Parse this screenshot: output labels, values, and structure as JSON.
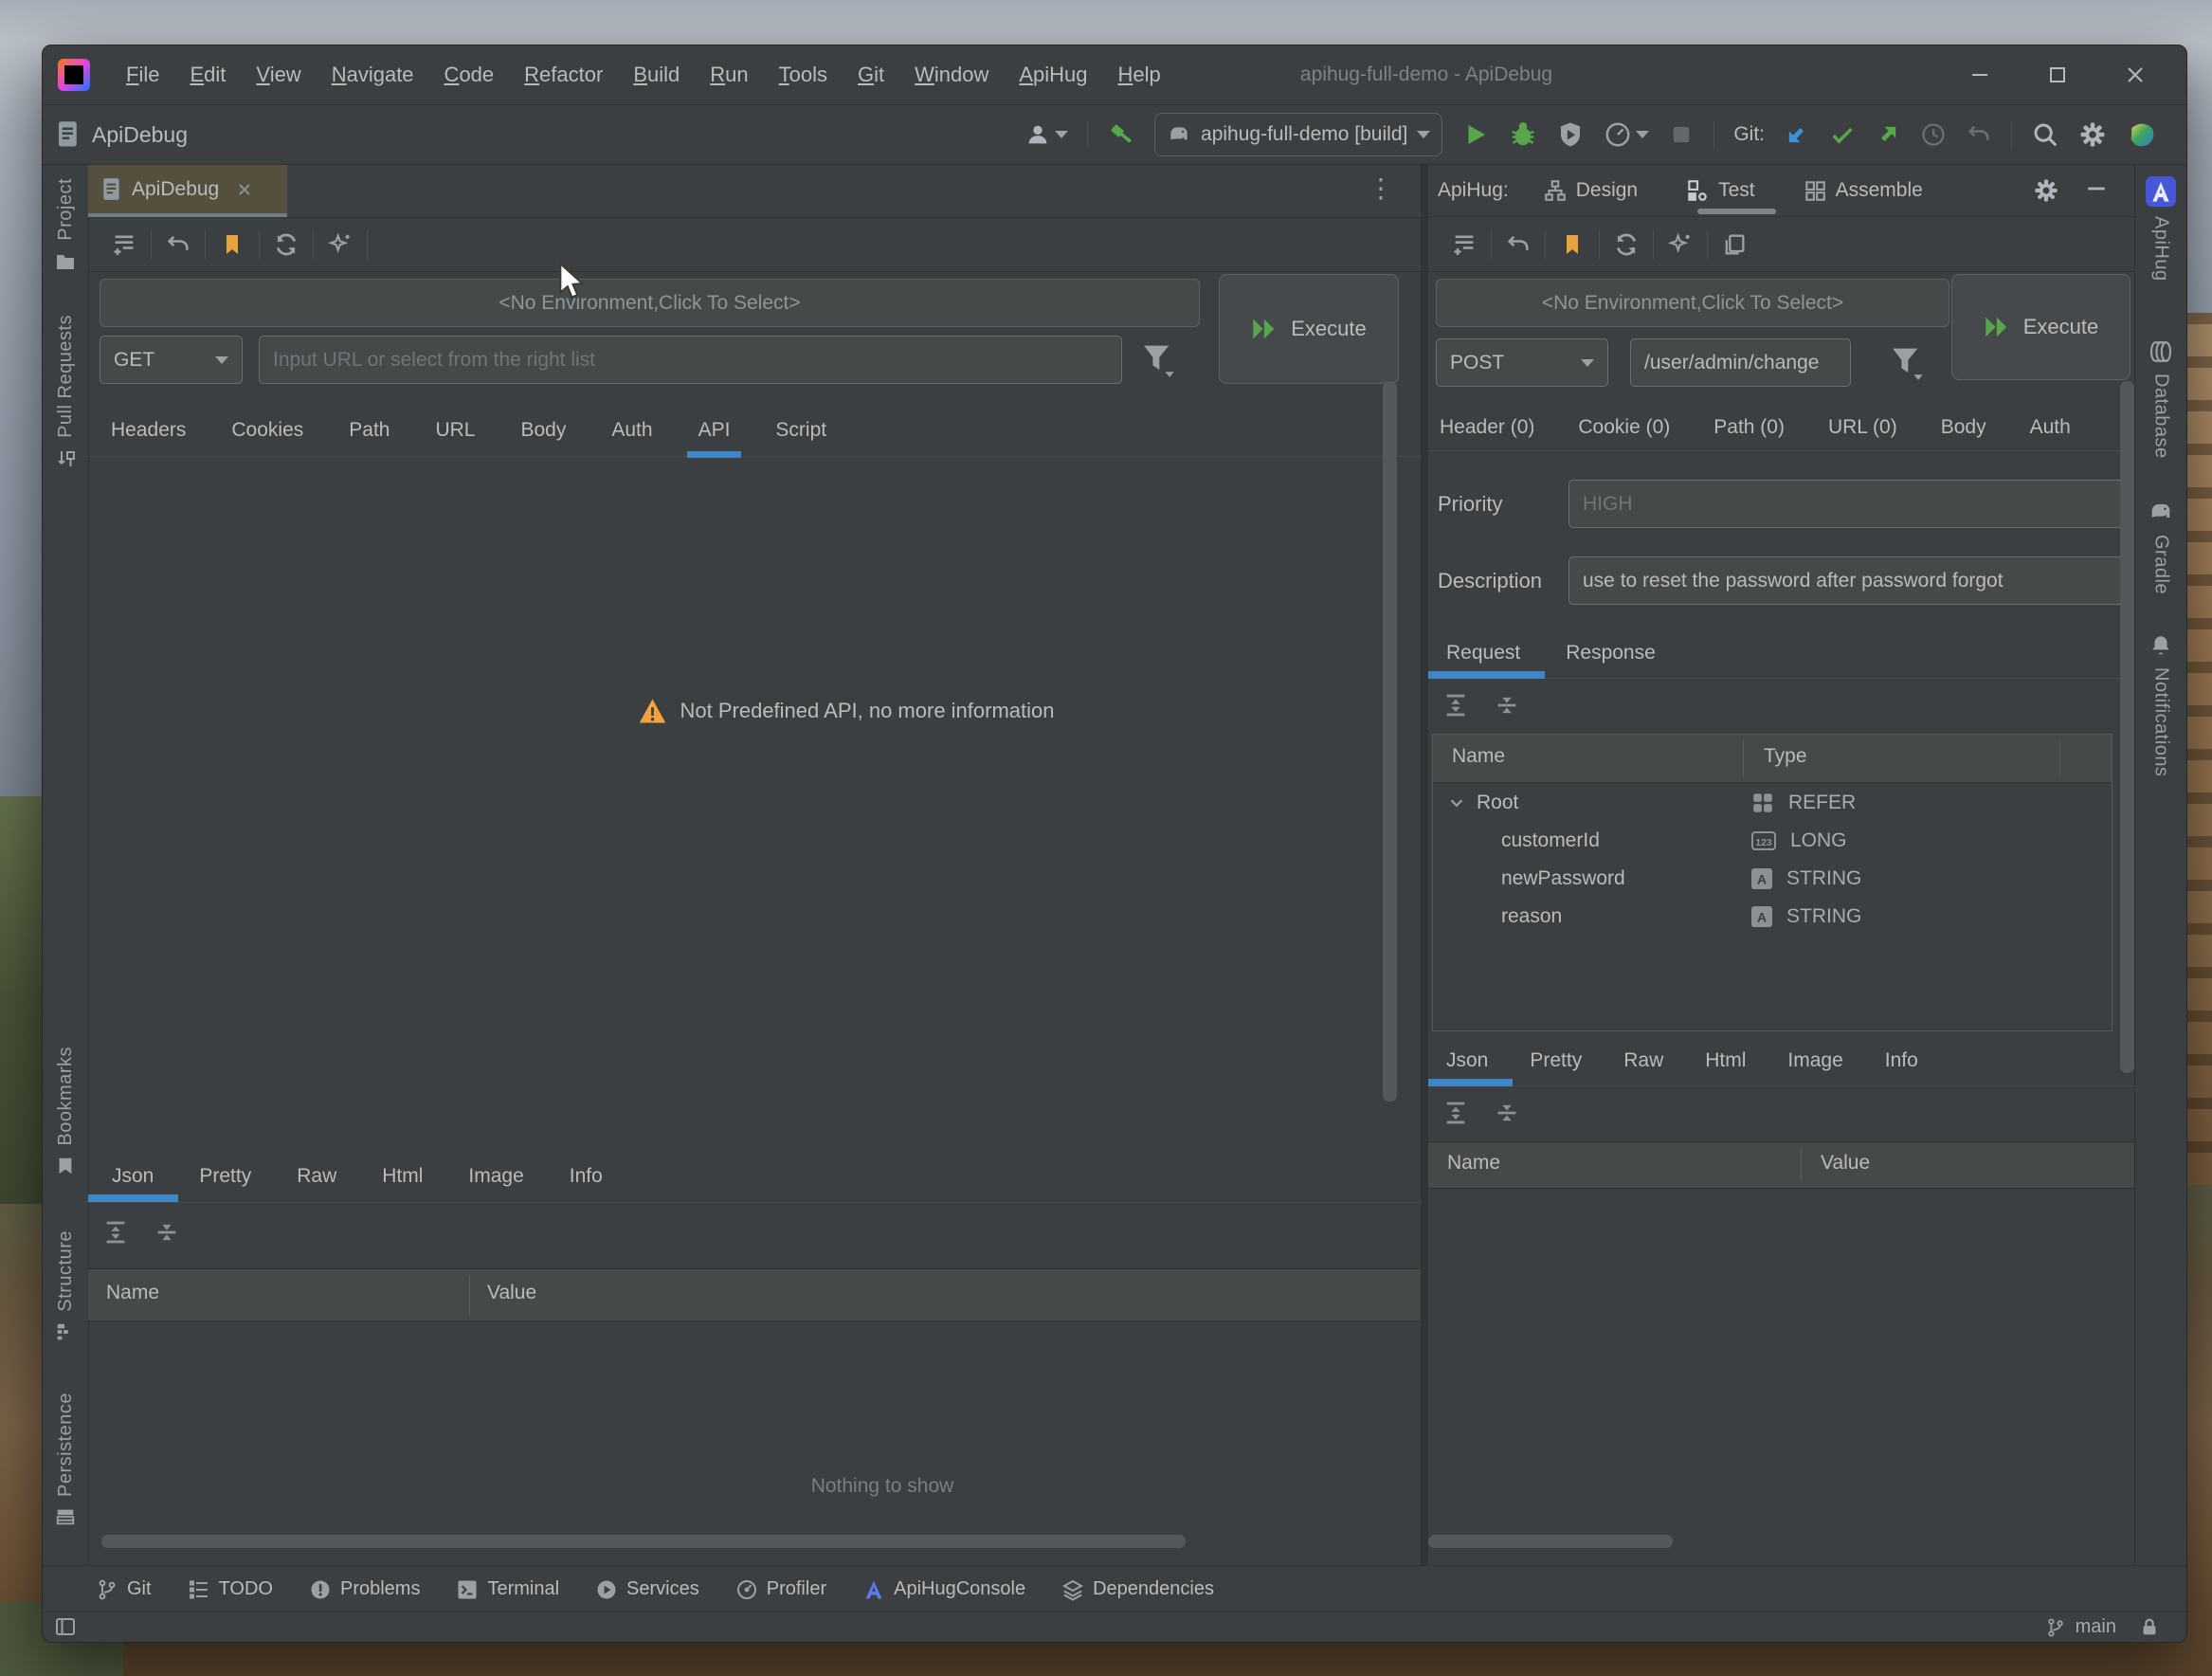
{
  "titlebar": {
    "menus": [
      "File",
      "Edit",
      "View",
      "Navigate",
      "Code",
      "Refactor",
      "Build",
      "Run",
      "Tools",
      "Git",
      "Window",
      "ApiHug",
      "Help"
    ],
    "title": "apihug-full-demo - ApiDebug"
  },
  "toolbar": {
    "app_label": "ApiDebug",
    "run_config": "apihug-full-demo [build]",
    "git_label": "Git:"
  },
  "left_stripe": {
    "project": "Project",
    "pull_requests": "Pull Requests",
    "bookmarks": "Bookmarks",
    "structure": "Structure",
    "persistence": "Persistence"
  },
  "left": {
    "tab": "ApiDebug",
    "env": "<No Environment,Click To Select>",
    "method": "GET",
    "url_placeholder": "Input URL or select from the right list",
    "execute": "Execute",
    "req_tabs": [
      "Headers",
      "Cookies",
      "Path",
      "URL",
      "Body",
      "Auth",
      "API",
      "Script"
    ],
    "active_req_tab": "API",
    "warning": "Not Predefined API, no more information",
    "res_tabs": [
      "Json",
      "Pretty",
      "Raw",
      "Html",
      "Image",
      "Info"
    ],
    "active_res_tab": "Json",
    "cols": {
      "name": "Name",
      "value": "Value"
    },
    "empty": "Nothing to show"
  },
  "right": {
    "label": "ApiHug:",
    "modes": [
      "Design",
      "Test",
      "Assemble"
    ],
    "active_mode": "Test",
    "env": "<No Environment,Click To Select>",
    "method": "POST",
    "url": "/user/admin/change",
    "execute": "Execute",
    "count_tabs": [
      "Header (0)",
      "Cookie (0)",
      "Path (0)",
      "URL (0)",
      "Body",
      "Auth"
    ],
    "priority_label": "Priority",
    "priority_placeholder": "HIGH",
    "description_label": "Description",
    "description_value": "use to reset the password after password forgot",
    "rr_tabs": [
      "Request",
      "Response"
    ],
    "active_rr_tab": "Request",
    "schema_cols": {
      "name": "Name",
      "type": "Type"
    },
    "schema": [
      {
        "name": "Root",
        "type": "REFER"
      },
      {
        "name": "customerId",
        "type": "LONG"
      },
      {
        "name": "newPassword",
        "type": "STRING"
      },
      {
        "name": "reason",
        "type": "STRING"
      }
    ],
    "res_tabs": [
      "Json",
      "Pretty",
      "Raw",
      "Html",
      "Image",
      "Info"
    ],
    "active_res_tab": "Json",
    "cols": {
      "name": "Name",
      "value": "Value"
    }
  },
  "right_stripe": {
    "apihug": "ApiHug",
    "database": "Database",
    "gradle": "Gradle",
    "notifications": "Notifications"
  },
  "bottom_bar": [
    "Git",
    "TODO",
    "Problems",
    "Terminal",
    "Services",
    "Profiler",
    "ApiHugConsole",
    "Dependencies"
  ],
  "status": {
    "branch": "main"
  },
  "colors": {
    "panel": "#3C3F41",
    "accent_blue": "#3E86C7",
    "bookmark_orange": "#E8A33D",
    "run_green": "#57A64B",
    "warning_yellow": "#F2A33C",
    "selected_tab": "#55503E"
  }
}
